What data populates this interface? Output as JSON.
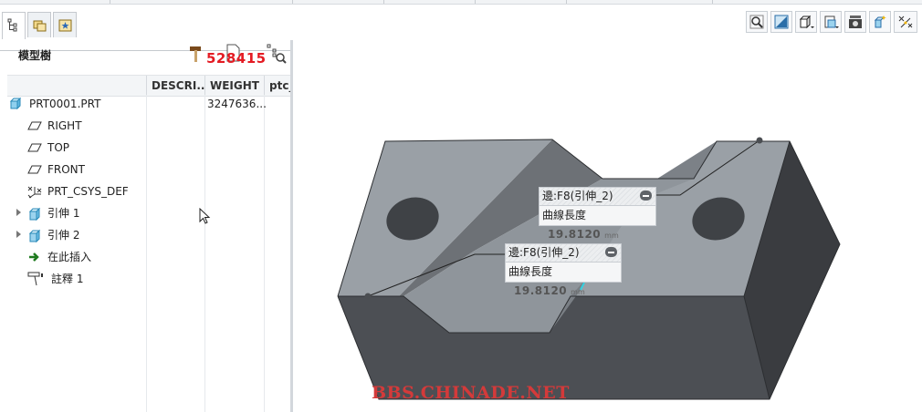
{
  "tree": {
    "title": "模型樹",
    "watermark_id": "528415",
    "columns": [
      "DESCRI...",
      "WEIGHT",
      "ptc_"
    ],
    "items": [
      {
        "label": "PRT0001.PRT",
        "weight": "3247636..."
      },
      {
        "label": "RIGHT"
      },
      {
        "label": "TOP"
      },
      {
        "label": "FRONT"
      },
      {
        "label": "PRT_CSYS_DEF"
      },
      {
        "label": "引伸 1"
      },
      {
        "label": "引伸 2"
      },
      {
        "label": "在此插入"
      },
      {
        "label": "註釋 1"
      }
    ]
  },
  "callouts": [
    {
      "title": "邊:F8(引伸_2)",
      "measure_label": "曲線長度",
      "value": "19.8120",
      "unit": "mm"
    },
    {
      "title": "邊:F8(引伸_2)",
      "measure_label": "曲線長度",
      "value": "19.8120",
      "unit": "mm"
    }
  ],
  "view_toolbar": [
    "zoom-icon",
    "repaint-icon",
    "display-style-icon",
    "saved-views-icon",
    "view-manager-icon",
    "spin-center-icon",
    "datum-display-icon"
  ],
  "watermark_text": "BBS.CHINADE.NET",
  "colors": {
    "model_top": "#9aa0a6",
    "model_front": "#4a4d52",
    "model_side": "#3a3c40",
    "watermark": "#d43a3a"
  }
}
